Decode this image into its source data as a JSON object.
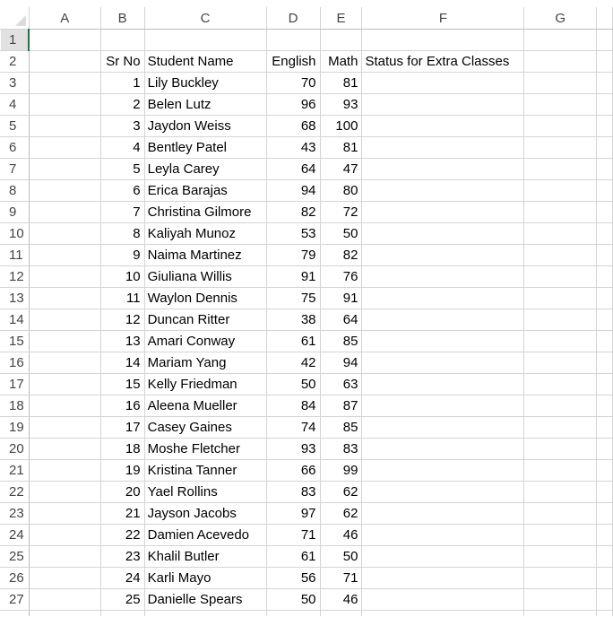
{
  "spreadsheet": {
    "column_headers": [
      "A",
      "B",
      "C",
      "D",
      "E",
      "F",
      "G"
    ],
    "active_cell": "A1",
    "header_row": {
      "row_number": "2",
      "sr_no": "Sr No",
      "student_name": "Student Name",
      "english": "English",
      "math": "Math",
      "status": "Status for Extra Classes"
    },
    "row1_number": "1",
    "students": [
      {
        "row": "3",
        "sr": "1",
        "name": "Lily Buckley",
        "english": "70",
        "math": "81"
      },
      {
        "row": "4",
        "sr": "2",
        "name": "Belen Lutz",
        "english": "96",
        "math": "93"
      },
      {
        "row": "5",
        "sr": "3",
        "name": "Jaydon Weiss",
        "english": "68",
        "math": "100"
      },
      {
        "row": "6",
        "sr": "4",
        "name": "Bentley Patel",
        "english": "43",
        "math": "81"
      },
      {
        "row": "7",
        "sr": "5",
        "name": "Leyla Carey",
        "english": "64",
        "math": "47"
      },
      {
        "row": "8",
        "sr": "6",
        "name": "Erica Barajas",
        "english": "94",
        "math": "80"
      },
      {
        "row": "9",
        "sr": "7",
        "name": "Christina Gilmore",
        "english": "82",
        "math": "72"
      },
      {
        "row": "10",
        "sr": "8",
        "name": "Kaliyah Munoz",
        "english": "53",
        "math": "50"
      },
      {
        "row": "11",
        "sr": "9",
        "name": "Naima Martinez",
        "english": "79",
        "math": "82"
      },
      {
        "row": "12",
        "sr": "10",
        "name": "Giuliana Willis",
        "english": "91",
        "math": "76"
      },
      {
        "row": "13",
        "sr": "11",
        "name": "Waylon Dennis",
        "english": "75",
        "math": "91"
      },
      {
        "row": "14",
        "sr": "12",
        "name": "Duncan Ritter",
        "english": "38",
        "math": "64"
      },
      {
        "row": "15",
        "sr": "13",
        "name": "Amari Conway",
        "english": "61",
        "math": "85"
      },
      {
        "row": "16",
        "sr": "14",
        "name": "Mariam Yang",
        "english": "42",
        "math": "94"
      },
      {
        "row": "17",
        "sr": "15",
        "name": "Kelly Friedman",
        "english": "50",
        "math": "63"
      },
      {
        "row": "18",
        "sr": "16",
        "name": "Aleena Mueller",
        "english": "84",
        "math": "87"
      },
      {
        "row": "19",
        "sr": "17",
        "name": "Casey Gaines",
        "english": "74",
        "math": "85"
      },
      {
        "row": "20",
        "sr": "18",
        "name": "Moshe Fletcher",
        "english": "93",
        "math": "83"
      },
      {
        "row": "21",
        "sr": "19",
        "name": "Kristina Tanner",
        "english": "66",
        "math": "99"
      },
      {
        "row": "22",
        "sr": "20",
        "name": "Yael Rollins",
        "english": "83",
        "math": "62"
      },
      {
        "row": "23",
        "sr": "21",
        "name": "Jayson Jacobs",
        "english": "97",
        "math": "62"
      },
      {
        "row": "24",
        "sr": "22",
        "name": "Damien Acevedo",
        "english": "71",
        "math": "46"
      },
      {
        "row": "25",
        "sr": "23",
        "name": "Khalil Butler",
        "english": "61",
        "math": "50"
      },
      {
        "row": "26",
        "sr": "24",
        "name": "Karli Mayo",
        "english": "56",
        "math": "71"
      },
      {
        "row": "27",
        "sr": "25",
        "name": "Danielle Spears",
        "english": "50",
        "math": "46"
      }
    ]
  },
  "colors": {
    "active_indicator": "#217346",
    "gridline": "#d4d4d4",
    "header_highlight": "#e1e1e1"
  }
}
